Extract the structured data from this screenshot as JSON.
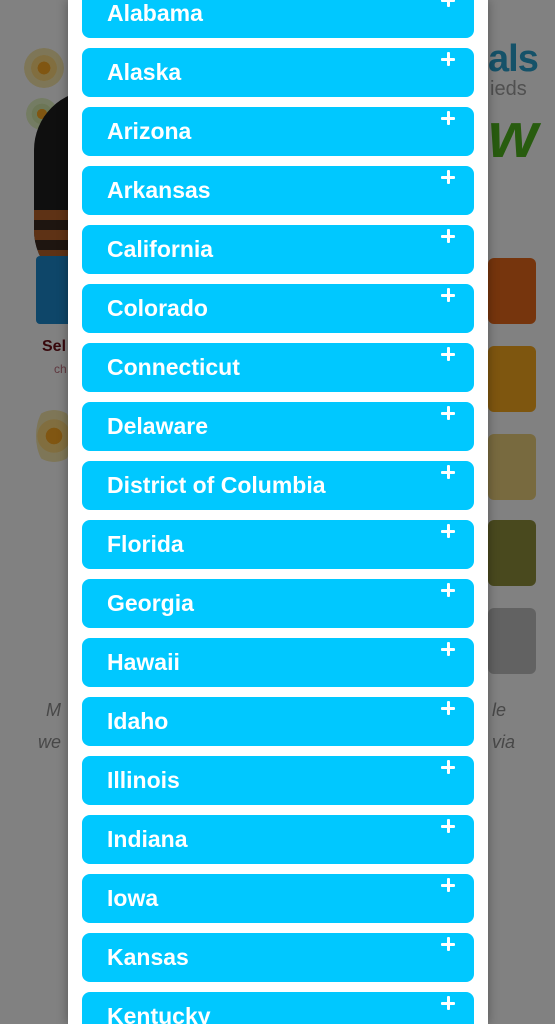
{
  "states": [
    {
      "label": "Alabama",
      "icon": "plus-icon"
    },
    {
      "label": "Alaska",
      "icon": "plus-icon"
    },
    {
      "label": "Arizona",
      "icon": "plus-icon"
    },
    {
      "label": "Arkansas",
      "icon": "plus-icon"
    },
    {
      "label": "California",
      "icon": "plus-icon"
    },
    {
      "label": "Colorado",
      "icon": "plus-icon"
    },
    {
      "label": "Connecticut",
      "icon": "plus-icon"
    },
    {
      "label": "Delaware",
      "icon": "plus-icon"
    },
    {
      "label": "District of Columbia",
      "icon": "plus-icon"
    },
    {
      "label": "Florida",
      "icon": "plus-icon"
    },
    {
      "label": "Georgia",
      "icon": "plus-icon"
    },
    {
      "label": "Hawaii",
      "icon": "plus-icon"
    },
    {
      "label": "Idaho",
      "icon": "plus-icon"
    },
    {
      "label": "Illinois",
      "icon": "plus-icon"
    },
    {
      "label": "Indiana",
      "icon": "plus-icon"
    },
    {
      "label": "Iowa",
      "icon": "plus-icon"
    },
    {
      "label": "Kansas",
      "icon": "plus-icon"
    },
    {
      "label": "Kentucky",
      "icon": "plus-icon"
    }
  ],
  "background": {
    "select_text": "Sel",
    "link_text": "ch",
    "logo_text": "als",
    "logo_sub": "ieds",
    "logo_letter": "w",
    "italic_left_1": "M",
    "italic_left_2": "we",
    "italic_right_1": "le",
    "italic_right_2": "via"
  },
  "colors": {
    "state_button": "#00c8ff",
    "state_label": "#ffffff",
    "modal_background": "#ffffff"
  }
}
